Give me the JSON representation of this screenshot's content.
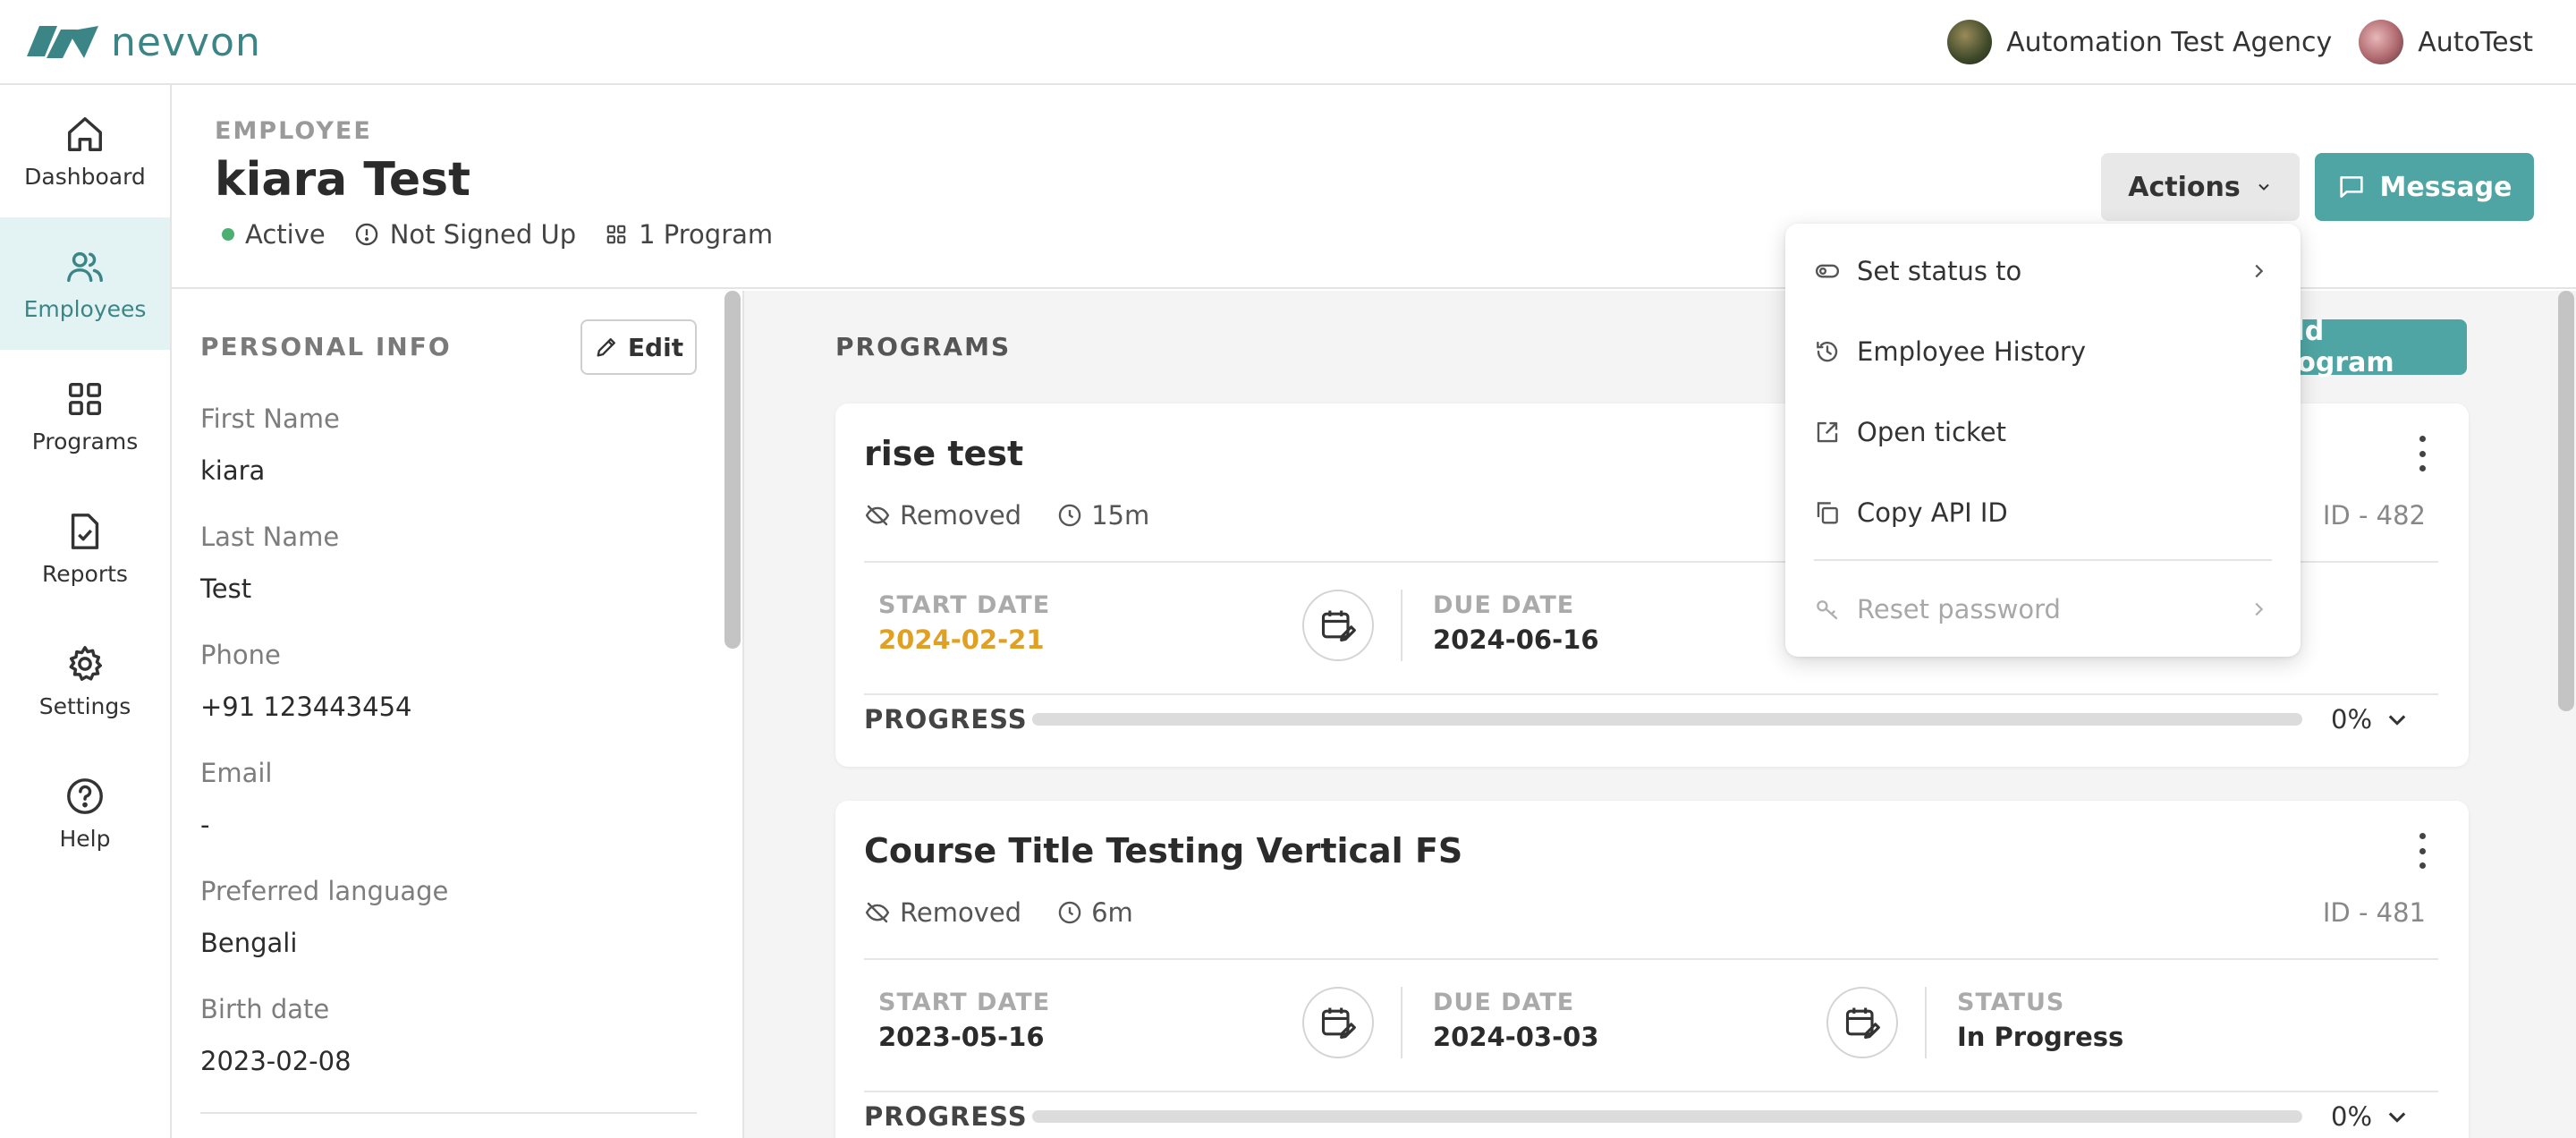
{
  "app": {
    "brand": "nevvon",
    "agency": "Automation Test Agency",
    "user": "AutoTest",
    "accent_color": "#4fa5a3"
  },
  "sidebar": {
    "items": [
      {
        "label": "Dashboard",
        "icon": "home-icon",
        "active": false
      },
      {
        "label": "Employees",
        "icon": "users-icon",
        "active": true
      },
      {
        "label": "Programs",
        "icon": "grid-icon",
        "active": false
      },
      {
        "label": "Reports",
        "icon": "report-icon",
        "active": false
      },
      {
        "label": "Settings",
        "icon": "gear-icon",
        "active": false
      },
      {
        "label": "Help",
        "icon": "help-icon",
        "active": false
      }
    ]
  },
  "header": {
    "eyebrow": "EMPLOYEE",
    "name": "kiara Test",
    "status": "Active",
    "signup": "Not Signed Up",
    "programs_count": "1 Program",
    "actions_label": "Actions",
    "message_label": "Message"
  },
  "personal_info": {
    "title": "PERSONAL INFO",
    "edit_label": "Edit",
    "fields": [
      {
        "label": "First Name",
        "value": "kiara"
      },
      {
        "label": "Last Name",
        "value": "Test"
      },
      {
        "label": "Phone",
        "value": "+91 123443454"
      },
      {
        "label": "Email",
        "value": "-"
      },
      {
        "label": "Preferred language",
        "value": "Bengali"
      },
      {
        "label": "Birth date",
        "value": "2023-02-08"
      }
    ]
  },
  "programs": {
    "title": "PROGRAMS",
    "add_label": "Add program",
    "cards": [
      {
        "title": "rise test",
        "visibility": "Removed",
        "duration": "15m",
        "id": "ID - 482",
        "start_label": "START DATE",
        "start_date": "2024-02-21",
        "start_color": "#e0a023",
        "due_label": "DUE DATE",
        "due_date": "2024-06-16",
        "progress_label": "PROGRESS",
        "progress_pct": "0%",
        "progress_value": 0
      },
      {
        "title": "Course Title Testing Vertical FS",
        "visibility": "Removed",
        "duration": "6m",
        "id": "ID - 481",
        "start_label": "START DATE",
        "start_date": "2023-05-16",
        "start_color": "#2b2b2b",
        "due_label": "DUE DATE",
        "due_date": "2024-03-03",
        "status_label": "STATUS",
        "status_value": "In Progress",
        "progress_label": "PROGRESS",
        "progress_pct": "0%",
        "progress_value": 0
      }
    ]
  },
  "actions_menu": {
    "items": [
      {
        "label": "Set status to",
        "icon": "toggle-icon",
        "submenu": true,
        "disabled": false
      },
      {
        "label": "Employee History",
        "icon": "history-icon",
        "submenu": false,
        "disabled": false
      },
      {
        "label": "Open ticket",
        "icon": "external-link-icon",
        "submenu": false,
        "disabled": false
      },
      {
        "label": "Copy API ID",
        "icon": "copy-icon",
        "submenu": false,
        "disabled": false
      },
      {
        "label": "Reset password",
        "icon": "key-icon",
        "submenu": true,
        "disabled": true
      }
    ]
  }
}
